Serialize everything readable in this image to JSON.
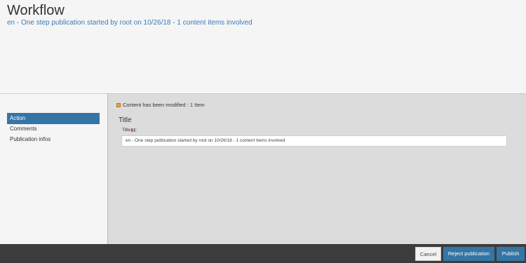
{
  "header": {
    "title": "Workflow",
    "subtitle": "en - One step publication started by root on 10/26/18 - 1 content items involved"
  },
  "sidebar": {
    "items": [
      {
        "label": "Action"
      },
      {
        "label": "Comments"
      },
      {
        "label": "Publication infos"
      }
    ]
  },
  "main": {
    "modified_text": "Content has been modified : 1 Item",
    "section_title": "Title",
    "field_label": "Title",
    "field_suffix": ":",
    "field_value": "en - One step publication started by root on 10/26/18 - 1 content items involved"
  },
  "footer": {
    "cancel_label": "Cancel",
    "reject_label": "Reject publication",
    "publish_label": "Publish"
  },
  "colors": {
    "accent": "#3475a6",
    "subtitle": "#3a7ab8",
    "footer_bg": "#3c3c3c"
  }
}
